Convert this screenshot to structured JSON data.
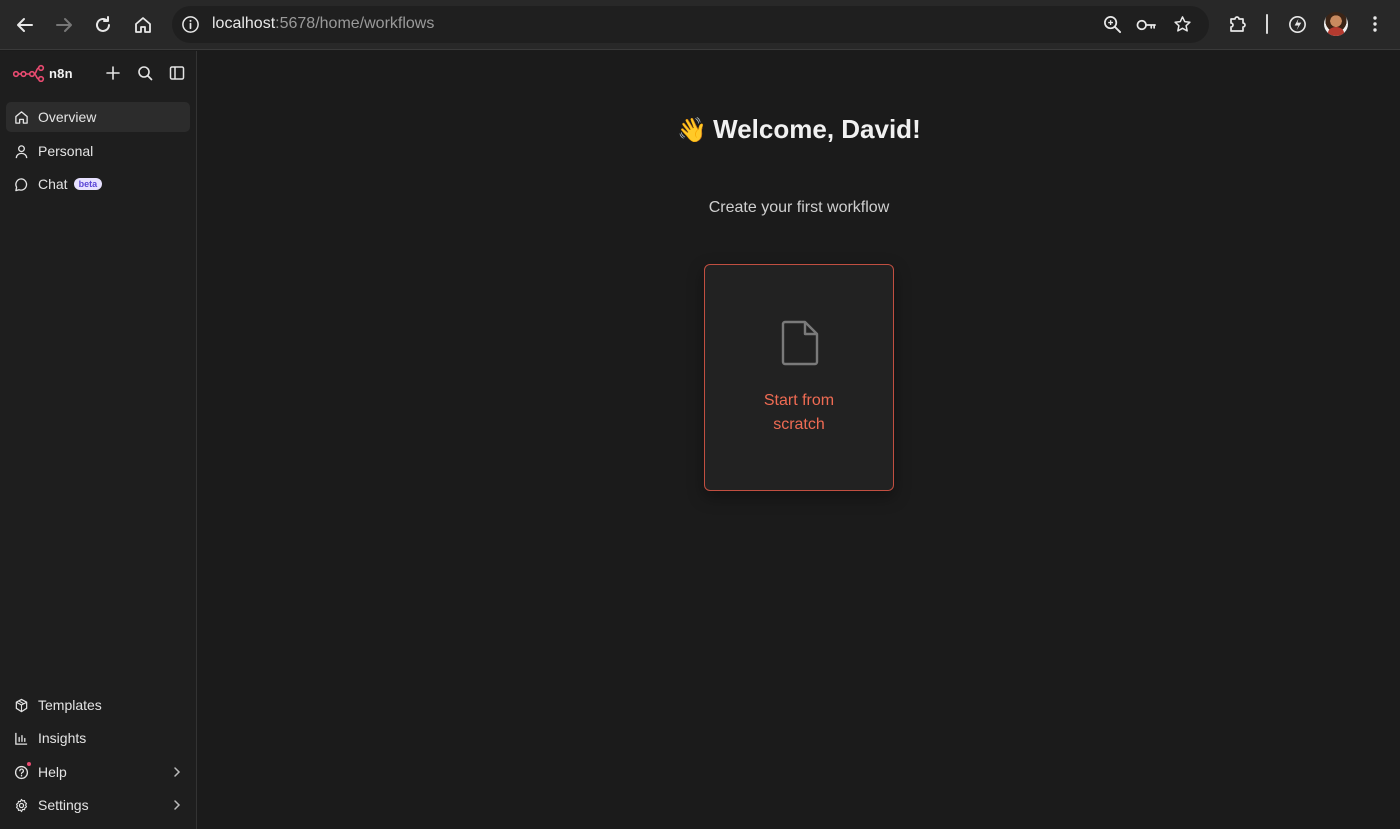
{
  "browser": {
    "url_host": "localhost",
    "url_rest": ":5678/home/workflows"
  },
  "app": {
    "name": "n8n",
    "brand_color": "#ea4b71",
    "accent_color": "#ef6b53"
  },
  "sidebar": {
    "top_items": [
      {
        "label": "Overview",
        "icon": "home-icon",
        "active": true
      },
      {
        "label": "Personal",
        "icon": "user-icon",
        "active": false
      },
      {
        "label": "Chat",
        "icon": "chat-bubble-icon",
        "badge": "beta",
        "active": false
      }
    ],
    "bottom_items": [
      {
        "label": "Templates",
        "icon": "templates-icon"
      },
      {
        "label": "Insights",
        "icon": "insights-chart-icon"
      },
      {
        "label": "Help",
        "icon": "help-circle-icon",
        "has_chevron": true
      },
      {
        "label": "Settings",
        "icon": "gear-icon",
        "has_chevron": true
      }
    ]
  },
  "main": {
    "greeting_emoji": "👋",
    "greeting": "Welcome, David!",
    "subtitle": "Create your first workflow",
    "card_label_line1": "Start from",
    "card_label_line2": "scratch"
  }
}
